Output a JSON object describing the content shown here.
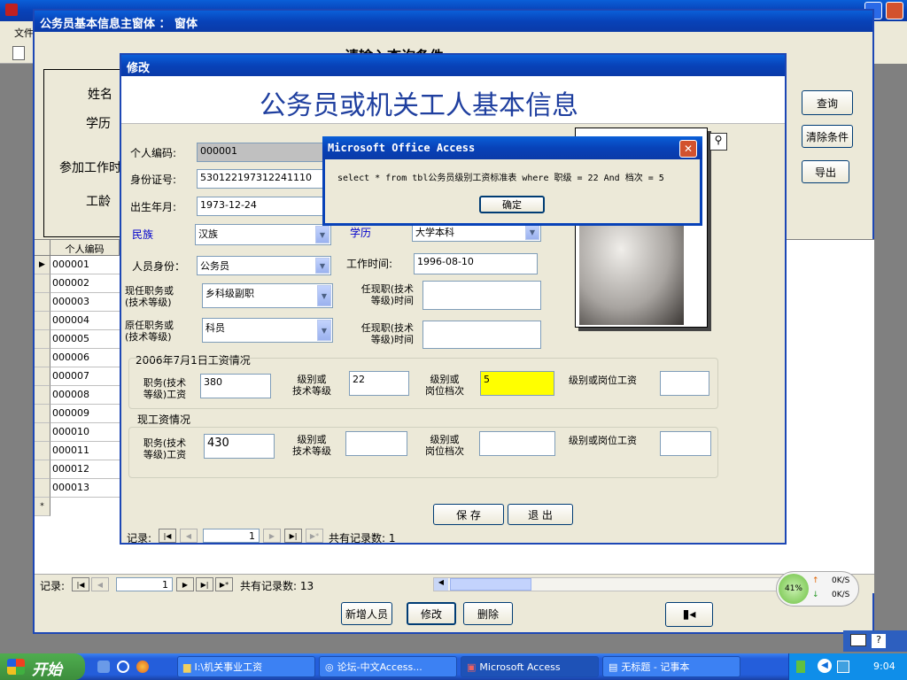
{
  "top_menu": {
    "file": "文件"
  },
  "main_form": {
    "title": "公务员基本信息主窗体 ： 窗体",
    "query_heading": "请输入查询条件",
    "name_label": "姓名",
    "edu_label": "学历",
    "work_start_label": "参加工作时",
    "seniority_label": "工龄",
    "grid_header": "个人编码",
    "grid_rows": [
      "000001",
      "000002",
      "000003",
      "000004",
      "000005",
      "000006",
      "000007",
      "000008",
      "000009",
      "000010",
      "000011",
      "000012",
      "000013"
    ],
    "buttons": {
      "query": "查询",
      "clear": "清除条件",
      "export": "导出"
    },
    "record_label": "记录:",
    "record_current": "1",
    "record_total": "共有记录数: 13",
    "bottom_buttons": {
      "add": "新增人员",
      "edit": "修改",
      "delete": "删除"
    }
  },
  "edit_form": {
    "title": "修改",
    "heading": "公务员或机关工人基本信息",
    "labels": {
      "id": "个人编码:",
      "idcard": "身份证号:",
      "birth": "出生年月:",
      "nation": "民族",
      "edu": "学历",
      "identity": "人员身份：",
      "work_time": "工作时间:",
      "cur_post": "现任职务或\n(技术等级)",
      "cur_post_time": "任现职(技术\n等级)时间",
      "orig_post": "原任职务或\n(技术等级)",
      "orig_post_time": "任现职(技术\n等级)时间",
      "sec2006": "2006年7月1日工资情况",
      "sec_now": "现工资情况",
      "post_wage": "职务(技术\n等级)工资",
      "level": "级别或\n技术等级",
      "grade": "级别或\n岗位档次",
      "level_wage": "级别或岗位工资"
    },
    "values": {
      "id": "000001",
      "idcard": "530122197312241110",
      "birth": "1973-12-24",
      "nation": "汉族",
      "edu": "大学本科",
      "identity": "公务员",
      "work_time": "1996-08-10",
      "cur_post": "乡科级副职",
      "orig_post": "科员",
      "w2006_post_wage": "380",
      "w2006_level": "22",
      "w2006_grade": "5",
      "now_post_wage": "430"
    },
    "buttons": {
      "save": "保 存",
      "exit": "退 出"
    },
    "record_label": "记录:",
    "record_current": "1",
    "record_total": "共有记录数: 1"
  },
  "dialog": {
    "title": "Microsoft Office Access",
    "message": "select * from tbl公务员级别工资标准表 where 职级 = 22  And 档次 = 5",
    "ok": "确定"
  },
  "net_widget": {
    "percent": "41%",
    "up": "0K/S",
    "down": "0K/S"
  },
  "taskbar": {
    "start": "开始",
    "items": [
      "I:\\机关事业工资",
      "论坛-中文Access...",
      "Microsoft Access",
      "无标题 - 记事本"
    ],
    "clock": "9:04"
  },
  "colors": {
    "title_blue": "#0842b8",
    "highlight_yellow": "#ffff00",
    "heading_blue": "#1f3f9f",
    "taskbar": "#245edb"
  }
}
